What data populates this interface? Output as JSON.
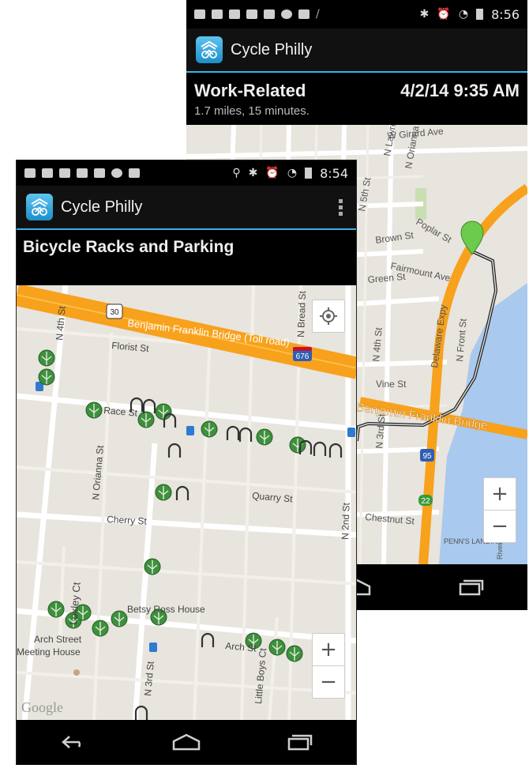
{
  "back_phone": {
    "status_time": "8:56",
    "app_title": "Cycle Philly",
    "trip": {
      "purpose": "Work-Related",
      "datetime": "4/2/14 9:35 AM",
      "summary": "1.7 miles, 15 minutes."
    },
    "map_labels": {
      "girard": "W Girard Ave",
      "lawrence": "N Lawrence St",
      "orianna": "N Orianna St",
      "fifth": "N 5th St",
      "poplar": "Poplar St",
      "brown": "Brown St",
      "fairmount": "Fairmount Ave",
      "green": "Green St",
      "delaware": "Delaware Expy",
      "front": "N Front St",
      "vine": "Vine St",
      "bridge": "Benjamin Franklin Bridge",
      "fourth": "N 4th St",
      "third": "N 3rd St",
      "chestnut": "Chestnut St",
      "penns": "PENN'S LANDING",
      "route95": "95",
      "route22": "22",
      "river": "River"
    },
    "zoom_in": "+",
    "zoom_out": "−"
  },
  "front_phone": {
    "status_time": "8:54",
    "app_title": "Cycle Philly",
    "page_title": "Bicycle Racks and Parking",
    "map_labels": {
      "route30": "30",
      "bridge": "Benjamin Franklin Bridge (Toll road)",
      "route676": "676",
      "bread": "N Bread St",
      "fourth": "N 4th St",
      "florist": "Florist St",
      "race": "Race St",
      "orianna": "N Orianna St",
      "quarry": "Quarry St",
      "second": "N 2nd St",
      "cherry": "Cherry St",
      "loxley": "Loxley Ct",
      "betsy": "Betsy Ross House",
      "arch_meeting_1": "Arch Street",
      "arch_meeting_2": "Meeting House",
      "arch": "Arch St",
      "third": "N 3rd St",
      "little_boys": "Little Boys Ct",
      "google": "Google"
    },
    "zoom_in": "+",
    "zoom_out": "−"
  },
  "colors": {
    "accent": "#33b5e5",
    "highway": "#f7a11c",
    "rack_green": "#3f8f3f",
    "map_bg": "#e8e4de",
    "water": "#a9c9ee"
  }
}
